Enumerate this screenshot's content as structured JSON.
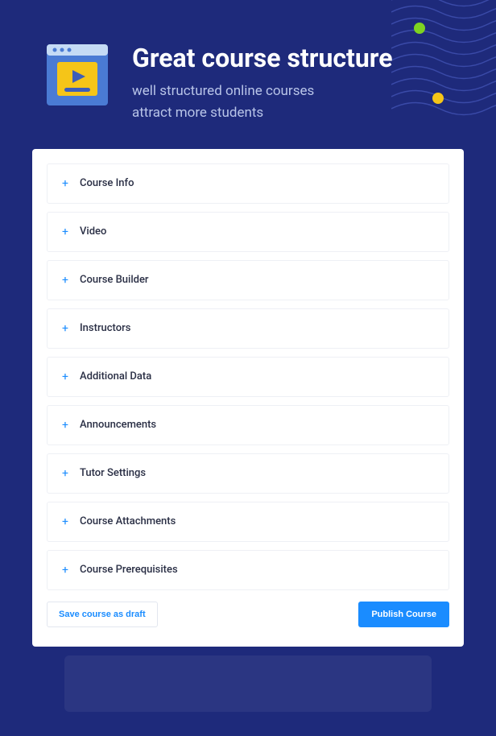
{
  "header": {
    "title": "Great course structure",
    "subtitle_line1": "well structured online courses",
    "subtitle_line2": "attract more students"
  },
  "accordion": {
    "items": [
      {
        "label": "Course Info"
      },
      {
        "label": "Video"
      },
      {
        "label": "Course Builder"
      },
      {
        "label": "Instructors"
      },
      {
        "label": "Additional Data"
      },
      {
        "label": "Announcements"
      },
      {
        "label": "Tutor Settings"
      },
      {
        "label": "Course Attachments"
      },
      {
        "label": "Course Prerequisites"
      }
    ]
  },
  "footer": {
    "draft_label": "Save course as draft",
    "publish_label": "Publish Course"
  }
}
